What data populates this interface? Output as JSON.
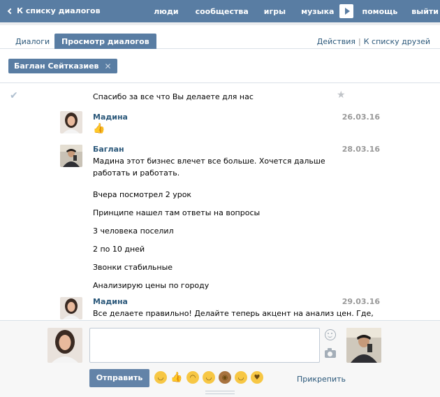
{
  "topbar": {
    "back_label": "К списку диалогов",
    "nav": [
      "люди",
      "сообщества",
      "игры",
      "музыка",
      "помощь",
      "выйти"
    ]
  },
  "tabs": {
    "dialogs": "Диалоги",
    "view_dialogs": "Просмотр диалогов",
    "actions": "Действия",
    "separator": "|",
    "to_friends": "К списку друзей"
  },
  "filter": {
    "name": "Баглан Сейткaзиев"
  },
  "messages": {
    "first_text": "Спасибо за все что Вы делаете для нас",
    "m1": {
      "name": "Мадина",
      "date": "26.03.16"
    },
    "m2": {
      "name": "Баглан",
      "date": "28.03.16",
      "text": "Мадина этот бизнес влечет все больше. Хочется дальше работать и работать.",
      "lines": [
        "Вчера посмотрел 2 урок",
        "Принципе нашел там ответы на вопросы",
        "3 человека поселил",
        "2 по 10 дней",
        "Звонки стабильные",
        "Анализирую цены по городу"
      ]
    },
    "m3": {
      "name": "Мадина",
      "date": "29.03.16",
      "text": "Все делаете правильно! Делайте теперь акцент на анализ цен. Где,"
    }
  },
  "composer": {
    "send_label": "Отправить",
    "attach_label": "Прикрепить"
  },
  "colors": {
    "header": "#597da3",
    "link": "#2b587a",
    "send": "#6383a8"
  }
}
